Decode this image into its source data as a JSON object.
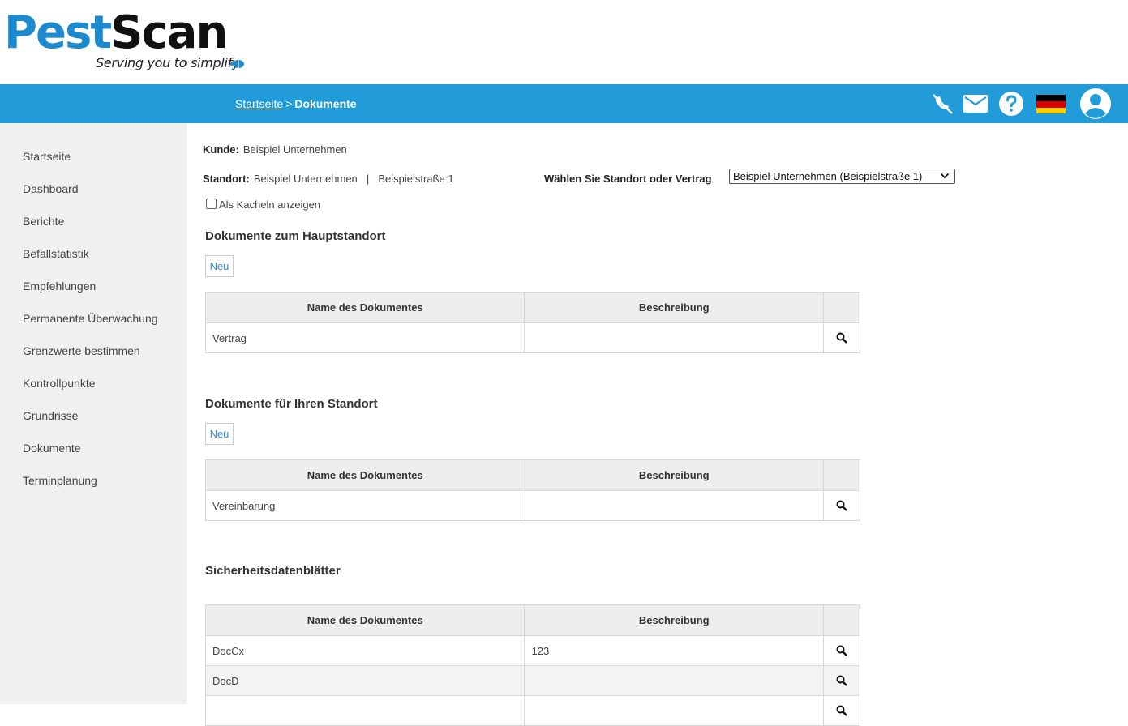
{
  "logo": {
    "part1": "Pest",
    "part2": "Scan",
    "tagline": "Serving you to simplify"
  },
  "colors": {
    "brand_blue": "#219cd9",
    "logo_blue": "#1d8ad0",
    "link_blue": "#3a8ed0",
    "sidebar_bg": "#f0f0f0"
  },
  "breadcrumb": {
    "home": "Startseite",
    "separator": ">",
    "current": "Dokumente"
  },
  "header_icons": [
    "phone-off-icon",
    "mail-icon",
    "help-icon",
    "german-flag-icon",
    "user-avatar-icon"
  ],
  "sidebar": {
    "items": [
      {
        "label": "Startseite"
      },
      {
        "label": "Dashboard"
      },
      {
        "label": "Berichte"
      },
      {
        "label": "Befallstatistik"
      },
      {
        "label": "Empfehlungen"
      },
      {
        "label": "Permanente Überwachung"
      },
      {
        "label": "Grenzwerte bestimmen"
      },
      {
        "label": "Kontrollpunkte"
      },
      {
        "label": "Grundrisse"
      },
      {
        "label": "Dokumente"
      },
      {
        "label": "Terminplanung"
      }
    ]
  },
  "info": {
    "kunde_label": "Kunde:",
    "kunde_value": "Beispiel Unternehmen",
    "standort_label": "Standort:",
    "standort_value": "Beispiel Unternehmen",
    "standort_sep": "|",
    "standort_address": "Beispielstraße 1",
    "select_label": "Wählen Sie Standort oder Vertrag",
    "select_value": "Beispiel Unternehmen (Beispielstraße 1)",
    "tiles_label": "Als Kacheln anzeigen"
  },
  "sections": [
    {
      "title": "Dokumente zum Hauptstandort",
      "new_label": "Neu",
      "columns": [
        "Name des Dokumentes",
        "Beschreibung"
      ],
      "rows": [
        {
          "name": "Vertrag",
          "description": ""
        }
      ]
    },
    {
      "title": "Dokumente für Ihren Standort",
      "new_label": "Neu",
      "columns": [
        "Name des Dokumentes",
        "Beschreibung"
      ],
      "rows": [
        {
          "name": "Vereinbarung",
          "description": ""
        }
      ]
    },
    {
      "title": "Sicherheitsdatenblätter",
      "columns": [
        "Name des Dokumentes",
        "Beschreibung"
      ],
      "rows": [
        {
          "name": "DocCx",
          "description": "123"
        },
        {
          "name": "DocD",
          "description": ""
        },
        {
          "name": "",
          "description": ""
        }
      ]
    }
  ]
}
